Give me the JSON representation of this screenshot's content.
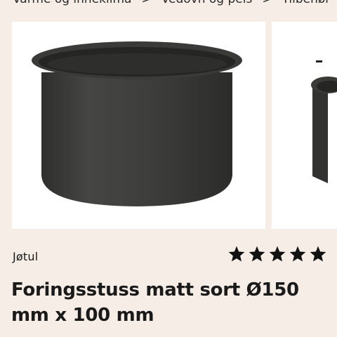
{
  "breadcrumb": {
    "items": [
      "Varme og inneklima",
      "Vedovn og peis",
      "Tilbehør"
    ],
    "separator": ">"
  },
  "gallery": {
    "images": [
      {
        "subject": "black-pipe-sleeve"
      },
      {
        "subject": "black-pipe-sleeve-partial"
      }
    ]
  },
  "product": {
    "brand": "Jøtul",
    "rating": 5,
    "rating_max": 5,
    "title": "Foringsstuss matt sort Ø150 mm x 100 mm"
  },
  "colors": {
    "background": "#f5ede6",
    "image_background": "#ffffff",
    "product": "#3a3a38",
    "star": "#111111"
  }
}
